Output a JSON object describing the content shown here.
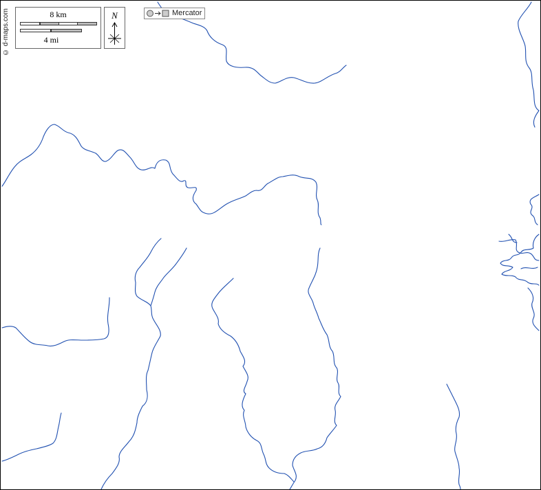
{
  "map": {
    "credit": "© d-maps.com",
    "scale": {
      "km_label": "8 km",
      "mi_label": "4 mi"
    },
    "compass": {
      "north_label": "N"
    },
    "projection": {
      "label": "Mercator",
      "icon": "globe-to-map-projection-icon"
    },
    "colors": {
      "river": "#1f4fb0",
      "frame": "#000000",
      "background": "#ffffff"
    }
  }
}
